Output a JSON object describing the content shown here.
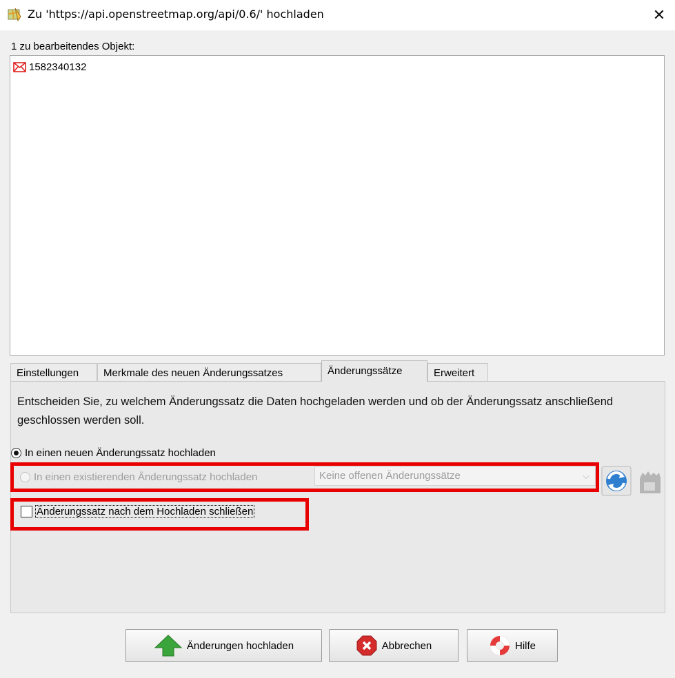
{
  "window": {
    "title": "Zu 'https://api.openstreetmap.org/api/0.6/' hochladen",
    "app_icon": "josm-map-icon",
    "close_icon": "close-icon"
  },
  "objects": {
    "label": "1 zu bearbeitendes Objekt:",
    "items": [
      {
        "icon": "relation-envelope-icon",
        "id": "1582340132"
      }
    ]
  },
  "tabs": [
    {
      "label": "Einstellungen",
      "active": false
    },
    {
      "label": "Merkmale des neuen Änderungssatzes",
      "active": false
    },
    {
      "label": "Änderungssätze",
      "active": true
    },
    {
      "label": "Erweitert",
      "active": false
    }
  ],
  "changeset_panel": {
    "description": "Entscheiden Sie, zu welchem Änderungssatz die Daten hochgeladen werden und ob der Änderungssatz anschließend geschlossen werden soll.",
    "radio_new": {
      "label": "In einen neuen Änderungssatz hochladen",
      "checked": true
    },
    "radio_existing": {
      "label": "In einen existierenden Änderungssatz hochladen",
      "checked": false,
      "enabled": false
    },
    "existing_select_value": "Keine offenen Änderungssätze",
    "refresh_icon": "refresh-icon",
    "close_changeset_icon": "close-changeset-icon",
    "close_after_upload": {
      "label": "Änderungssatz nach dem Hochladen schließen",
      "checked": false
    }
  },
  "buttons": {
    "upload": "Änderungen hochladen",
    "cancel": "Abbrechen",
    "help": "Hilfe"
  },
  "colors": {
    "highlight": "#e80000",
    "upload_arrow": "#3aa53a",
    "cancel_red": "#d42b2b"
  }
}
